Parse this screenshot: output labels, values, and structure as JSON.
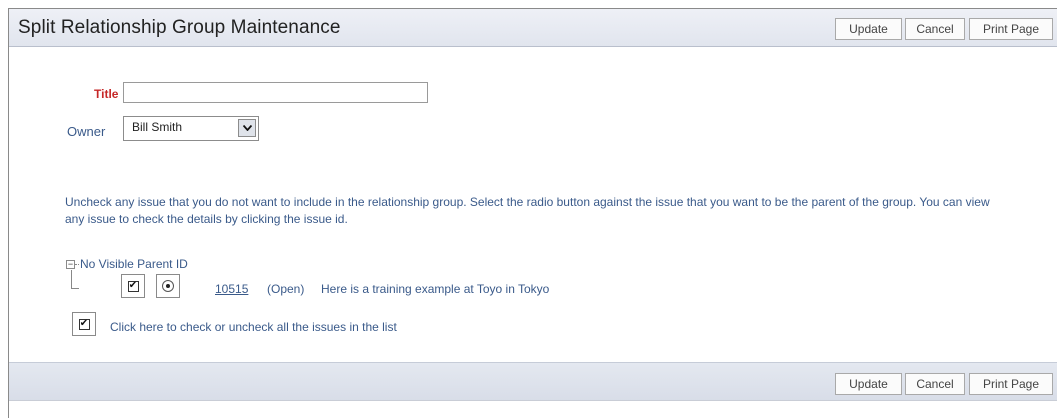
{
  "header": {
    "title": "Split Relationship Group Maintenance",
    "update_label": "Update",
    "cancel_label": "Cancel",
    "print_label": "Print Page"
  },
  "form": {
    "title_label": "Title",
    "title_value": "",
    "owner_label": "Owner",
    "owner_value": "Bill Smith"
  },
  "instructions": "Uncheck any issue that you do not want to include in the relationship group. Select the radio button against the issue that you want to be the parent of the group. You can view any issue to check the details by clicking the issue id.",
  "tree": {
    "group_label": "No Visible Parent ID",
    "issues": [
      {
        "id": "10515",
        "status": "(Open)",
        "description": "Here is a training example at Toyo in Tokyo",
        "checked": true,
        "parent_selected": true
      }
    ]
  },
  "check_all_label": "Click here to check or uncheck all the issues in the list",
  "footer": {
    "update_label": "Update",
    "cancel_label": "Cancel",
    "print_label": "Print Page"
  },
  "colors": {
    "required_label": "#c62828",
    "text": "#3a5a8a",
    "header_bg": "#e1e5ee"
  }
}
